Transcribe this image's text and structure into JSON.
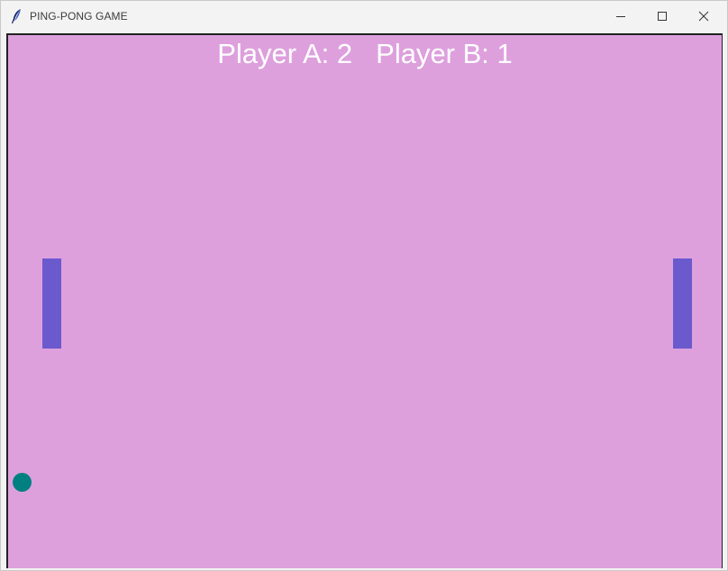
{
  "window": {
    "title": "PING-PONG GAME",
    "icon": "feather-icon",
    "controls": [
      "minimize-icon",
      "maximize-icon",
      "close-icon"
    ]
  },
  "game": {
    "score": {
      "player_a": "Player A: 2",
      "player_b": "Player B: 1"
    },
    "colors": {
      "background": "#dda0dd",
      "paddle": "#6a5acd",
      "ball": "#008080",
      "text": "#ffffff"
    }
  }
}
